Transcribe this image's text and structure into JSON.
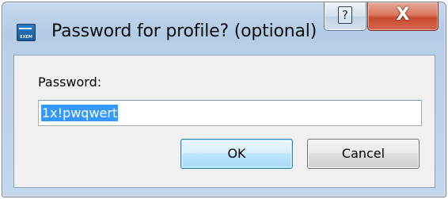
{
  "window": {
    "title": "Password for profile? (optional)",
    "app_icon_text": "EXEM"
  },
  "titlebar": {
    "help_label": "?",
    "close_label": "X"
  },
  "form": {
    "password_label": "Password:",
    "password_value": "1x!pwqwert"
  },
  "buttons": {
    "ok_label": "OK",
    "cancel_label": "Cancel"
  },
  "colors": {
    "selection": "#3399ff",
    "close_button": "#c74b32",
    "frame": "#b9cfe8"
  }
}
